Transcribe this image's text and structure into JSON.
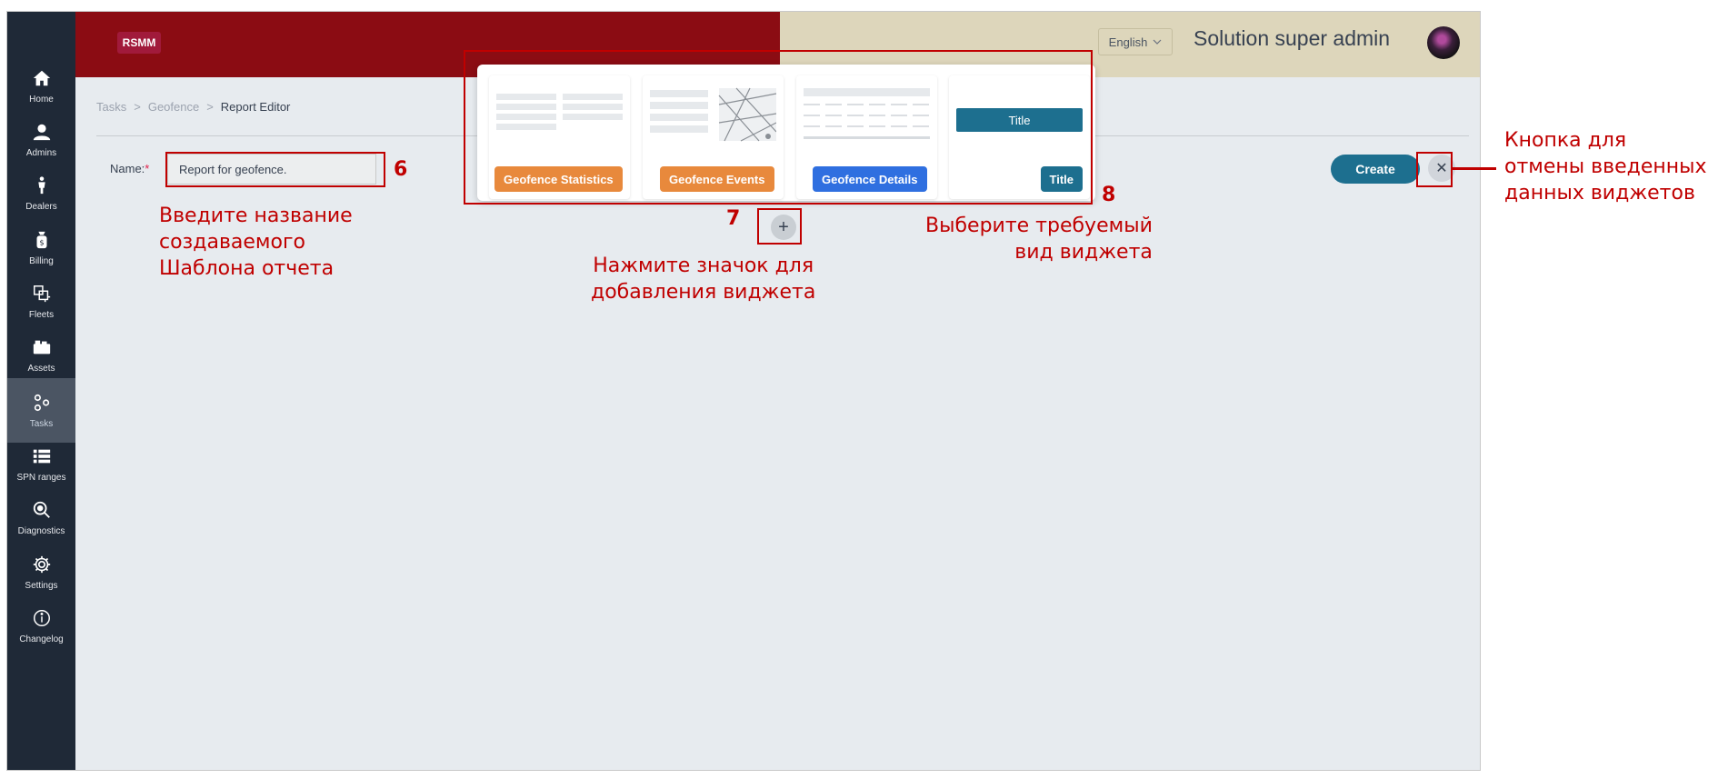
{
  "header": {
    "logo": "RSMM",
    "language": "English",
    "user_name": "Solution super admin",
    "colors": {
      "brand_red": "#8b0c13",
      "header_beige": "#ddd6bb",
      "accent_teal": "#1d6f8f"
    }
  },
  "sidebar": {
    "items": [
      {
        "label": "Home",
        "icon": "home-icon"
      },
      {
        "label": "Admins",
        "icon": "user-icon"
      },
      {
        "label": "Dealers",
        "icon": "person-icon"
      },
      {
        "label": "Billing",
        "icon": "wallet-icon"
      },
      {
        "label": "Fleets",
        "icon": "fleets-icon"
      },
      {
        "label": "Assets",
        "icon": "truck-icon"
      },
      {
        "label": "Tasks",
        "icon": "tasks-icon",
        "active": true
      },
      {
        "label": "SPN ranges",
        "icon": "list-icon"
      },
      {
        "label": "Diagnostics",
        "icon": "diagnostics-icon"
      },
      {
        "label": "Settings",
        "icon": "gear-icon"
      },
      {
        "label": "Changelog",
        "icon": "info-icon"
      }
    ]
  },
  "breadcrumb": [
    "Tasks",
    "Geofence",
    "Report Editor"
  ],
  "form": {
    "name_label": "Name:",
    "required_mark": "*",
    "name_value": "Report for geofence.",
    "create_label": "Create",
    "close_symbol": "✕",
    "add_symbol": "+"
  },
  "widgets": [
    {
      "label": "Geofence Statistics",
      "color": "#e8893c"
    },
    {
      "label": "Geofence Events",
      "color": "#e8893c"
    },
    {
      "label": "Geofence Details",
      "color": "#2f6fe0"
    },
    {
      "label": "Title",
      "preview": "Title",
      "color": "#1d6f8f"
    }
  ],
  "annotations": {
    "n6": "6",
    "n7": "7",
    "n8": "8",
    "name_hint": [
      "Введите название",
      "создаваемого",
      "Шаблона отчета"
    ],
    "add_hint": [
      "Нажмите значок для",
      "добавления виджета"
    ],
    "widget_hint": [
      "Выберите требуемый",
      "вид виджета"
    ],
    "cancel_hint": [
      "Кнопка для",
      "отмены введенных",
      "данных виджетов"
    ]
  }
}
